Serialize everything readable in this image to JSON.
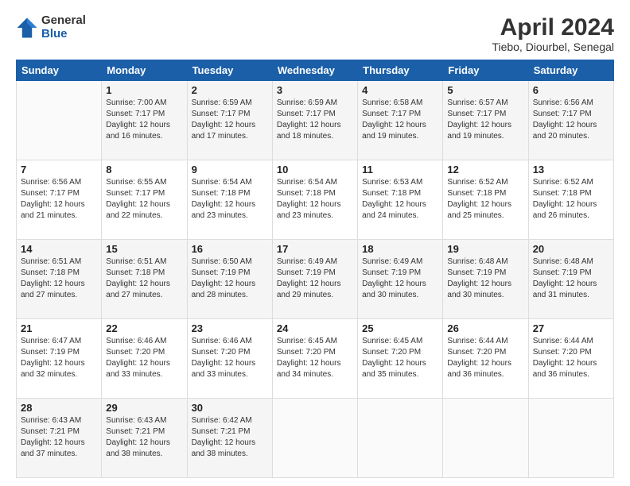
{
  "header": {
    "logo": {
      "line1": "General",
      "line2": "Blue"
    },
    "title": "April 2024",
    "location": "Tiebo, Diourbel, Senegal"
  },
  "columns": [
    "Sunday",
    "Monday",
    "Tuesday",
    "Wednesday",
    "Thursday",
    "Friday",
    "Saturday"
  ],
  "weeks": [
    [
      {
        "day": "",
        "info": ""
      },
      {
        "day": "1",
        "info": "Sunrise: 7:00 AM\nSunset: 7:17 PM\nDaylight: 12 hours\nand 16 minutes."
      },
      {
        "day": "2",
        "info": "Sunrise: 6:59 AM\nSunset: 7:17 PM\nDaylight: 12 hours\nand 17 minutes."
      },
      {
        "day": "3",
        "info": "Sunrise: 6:59 AM\nSunset: 7:17 PM\nDaylight: 12 hours\nand 18 minutes."
      },
      {
        "day": "4",
        "info": "Sunrise: 6:58 AM\nSunset: 7:17 PM\nDaylight: 12 hours\nand 19 minutes."
      },
      {
        "day": "5",
        "info": "Sunrise: 6:57 AM\nSunset: 7:17 PM\nDaylight: 12 hours\nand 19 minutes."
      },
      {
        "day": "6",
        "info": "Sunrise: 6:56 AM\nSunset: 7:17 PM\nDaylight: 12 hours\nand 20 minutes."
      }
    ],
    [
      {
        "day": "7",
        "info": "Sunrise: 6:56 AM\nSunset: 7:17 PM\nDaylight: 12 hours\nand 21 minutes."
      },
      {
        "day": "8",
        "info": "Sunrise: 6:55 AM\nSunset: 7:17 PM\nDaylight: 12 hours\nand 22 minutes."
      },
      {
        "day": "9",
        "info": "Sunrise: 6:54 AM\nSunset: 7:18 PM\nDaylight: 12 hours\nand 23 minutes."
      },
      {
        "day": "10",
        "info": "Sunrise: 6:54 AM\nSunset: 7:18 PM\nDaylight: 12 hours\nand 23 minutes."
      },
      {
        "day": "11",
        "info": "Sunrise: 6:53 AM\nSunset: 7:18 PM\nDaylight: 12 hours\nand 24 minutes."
      },
      {
        "day": "12",
        "info": "Sunrise: 6:52 AM\nSunset: 7:18 PM\nDaylight: 12 hours\nand 25 minutes."
      },
      {
        "day": "13",
        "info": "Sunrise: 6:52 AM\nSunset: 7:18 PM\nDaylight: 12 hours\nand 26 minutes."
      }
    ],
    [
      {
        "day": "14",
        "info": "Sunrise: 6:51 AM\nSunset: 7:18 PM\nDaylight: 12 hours\nand 27 minutes."
      },
      {
        "day": "15",
        "info": "Sunrise: 6:51 AM\nSunset: 7:18 PM\nDaylight: 12 hours\nand 27 minutes."
      },
      {
        "day": "16",
        "info": "Sunrise: 6:50 AM\nSunset: 7:19 PM\nDaylight: 12 hours\nand 28 minutes."
      },
      {
        "day": "17",
        "info": "Sunrise: 6:49 AM\nSunset: 7:19 PM\nDaylight: 12 hours\nand 29 minutes."
      },
      {
        "day": "18",
        "info": "Sunrise: 6:49 AM\nSunset: 7:19 PM\nDaylight: 12 hours\nand 30 minutes."
      },
      {
        "day": "19",
        "info": "Sunrise: 6:48 AM\nSunset: 7:19 PM\nDaylight: 12 hours\nand 30 minutes."
      },
      {
        "day": "20",
        "info": "Sunrise: 6:48 AM\nSunset: 7:19 PM\nDaylight: 12 hours\nand 31 minutes."
      }
    ],
    [
      {
        "day": "21",
        "info": "Sunrise: 6:47 AM\nSunset: 7:19 PM\nDaylight: 12 hours\nand 32 minutes."
      },
      {
        "day": "22",
        "info": "Sunrise: 6:46 AM\nSunset: 7:20 PM\nDaylight: 12 hours\nand 33 minutes."
      },
      {
        "day": "23",
        "info": "Sunrise: 6:46 AM\nSunset: 7:20 PM\nDaylight: 12 hours\nand 33 minutes."
      },
      {
        "day": "24",
        "info": "Sunrise: 6:45 AM\nSunset: 7:20 PM\nDaylight: 12 hours\nand 34 minutes."
      },
      {
        "day": "25",
        "info": "Sunrise: 6:45 AM\nSunset: 7:20 PM\nDaylight: 12 hours\nand 35 minutes."
      },
      {
        "day": "26",
        "info": "Sunrise: 6:44 AM\nSunset: 7:20 PM\nDaylight: 12 hours\nand 36 minutes."
      },
      {
        "day": "27",
        "info": "Sunrise: 6:44 AM\nSunset: 7:20 PM\nDaylight: 12 hours\nand 36 minutes."
      }
    ],
    [
      {
        "day": "28",
        "info": "Sunrise: 6:43 AM\nSunset: 7:21 PM\nDaylight: 12 hours\nand 37 minutes."
      },
      {
        "day": "29",
        "info": "Sunrise: 6:43 AM\nSunset: 7:21 PM\nDaylight: 12 hours\nand 38 minutes."
      },
      {
        "day": "30",
        "info": "Sunrise: 6:42 AM\nSunset: 7:21 PM\nDaylight: 12 hours\nand 38 minutes."
      },
      {
        "day": "",
        "info": ""
      },
      {
        "day": "",
        "info": ""
      },
      {
        "day": "",
        "info": ""
      },
      {
        "day": "",
        "info": ""
      }
    ]
  ]
}
